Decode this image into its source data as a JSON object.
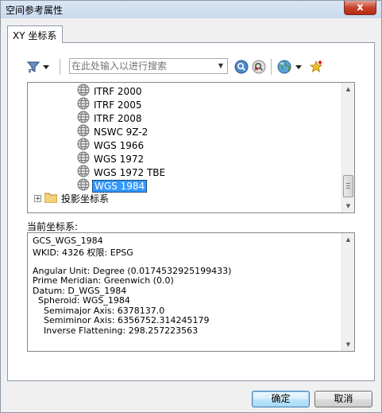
{
  "window": {
    "title": "空间参考属性",
    "close_glyph": "x"
  },
  "tab": {
    "label": "XY 坐标系"
  },
  "toolbar": {
    "search_placeholder": "在此处输入以进行搜索",
    "icons": [
      "filter-icon",
      "dropdown-arrow-icon",
      "search-icon",
      "clear-search-icon",
      "globe-icon",
      "dropdown-arrow-icon",
      "add-favorite-icon"
    ]
  },
  "tree": {
    "items": [
      {
        "label": "ITRF 2000"
      },
      {
        "label": "ITRF 2005"
      },
      {
        "label": "ITRF 2008"
      },
      {
        "label": "NSWC 9Z-2"
      },
      {
        "label": "WGS 1966"
      },
      {
        "label": "WGS 1972"
      },
      {
        "label": "WGS 1972 TBE"
      },
      {
        "label": "WGS 1984",
        "selected": true
      }
    ],
    "folder": {
      "label": "投影坐标系",
      "expander": "+"
    }
  },
  "current": {
    "label": "当前坐标系:",
    "lines": [
      "GCS_WGS_1984",
      "WKID: 4326 权限: EPSG",
      "",
      "Angular Unit: Degree (0.0174532925199433)",
      "Prime Meridian: Greenwich (0.0)",
      "Datum: D_WGS_1984",
      "  Spheroid: WGS_1984",
      "    Semimajor Axis: 6378137.0",
      "    Semiminor Axis: 6356752.314245179",
      "    Inverse Flattening: 298.257223563"
    ]
  },
  "buttons": {
    "ok": "确定",
    "cancel": "取消"
  },
  "colors": {
    "selection": "#3399ff",
    "titlebar": "#c9d9ee",
    "close": "#c7432c"
  }
}
